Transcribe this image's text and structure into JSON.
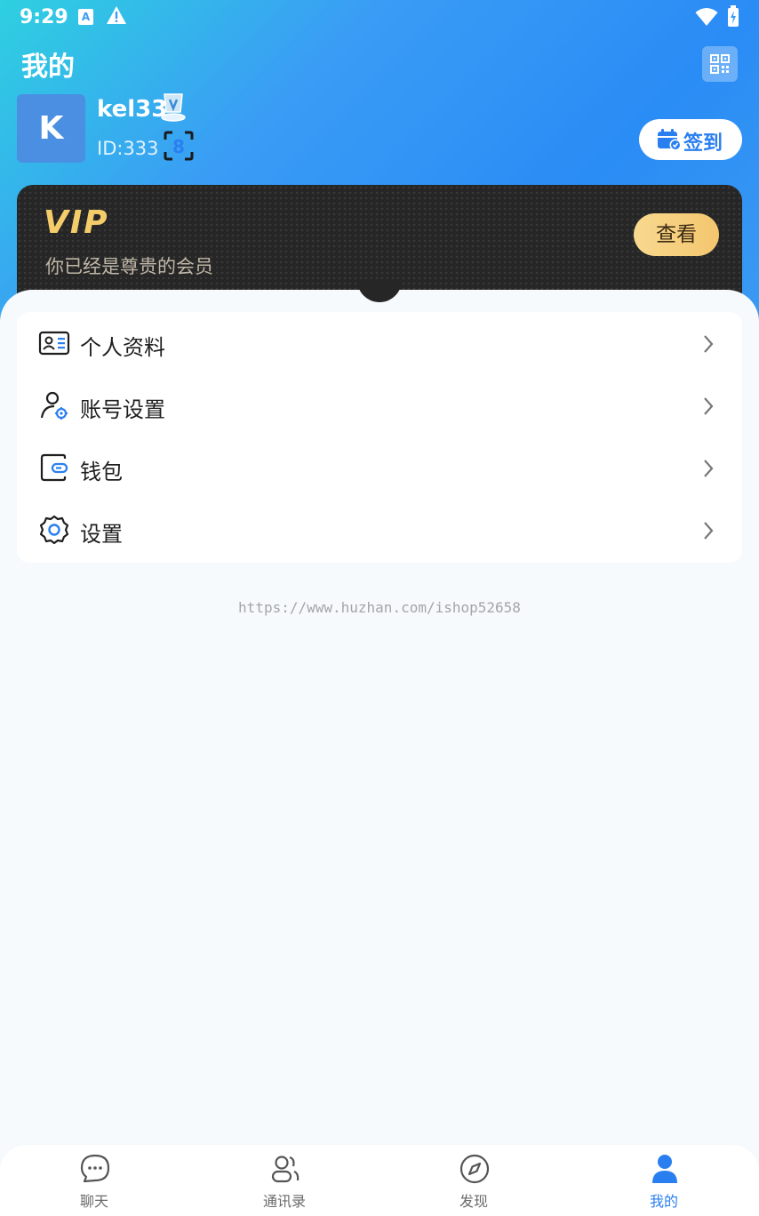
{
  "status_bar": {
    "time": "9:29",
    "a_icon": "A"
  },
  "header": {
    "title": "我的"
  },
  "profile": {
    "avatar_letter": "K",
    "username": "kel33",
    "id_text": "ID:333",
    "checkin_label": "签到"
  },
  "vip": {
    "title": "VIP",
    "subtitle": "你已经是尊贵的会员",
    "view_label": "查看"
  },
  "menu": {
    "items": [
      {
        "label": "个人资料",
        "icon": "profile-card-icon"
      },
      {
        "label": "账号设置",
        "icon": "account-settings-icon"
      },
      {
        "label": "钱包",
        "icon": "wallet-icon"
      },
      {
        "label": "设置",
        "icon": "gear-icon"
      }
    ]
  },
  "watermark": "https://www.huzhan.com/ishop52658",
  "bottom_nav": {
    "items": [
      {
        "label": "聊天",
        "icon": "chat-bubble-icon"
      },
      {
        "label": "通讯录",
        "icon": "contacts-icon"
      },
      {
        "label": "发现",
        "icon": "compass-icon"
      },
      {
        "label": "我的",
        "icon": "person-icon",
        "active": true
      }
    ]
  },
  "colors": {
    "accent": "#2a7ff0",
    "vip_gold": "#f4cc6a",
    "vip_bg": "#262626"
  }
}
